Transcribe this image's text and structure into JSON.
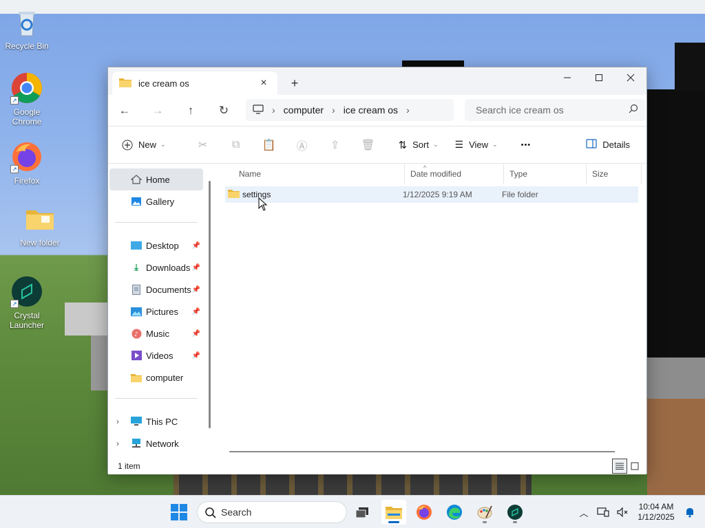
{
  "desktop": {
    "icons": [
      {
        "label": "Recycle Bin",
        "icon": "recycle-bin-icon"
      },
      {
        "label": "Google Chrome",
        "icon": "chrome-icon"
      },
      {
        "label": "Firefox",
        "icon": "firefox-icon"
      },
      {
        "label": "New folder",
        "icon": "folder-icon"
      },
      {
        "label": "Crystal Launcher",
        "icon": "crystal-launcher-icon"
      }
    ]
  },
  "window": {
    "tab_title": "ice cream os",
    "tab_close": "×",
    "new_tab": "+",
    "controls": {
      "minimize": "—",
      "maximize": "☐",
      "close": "✕"
    }
  },
  "address": {
    "back": "←",
    "forward": "→",
    "up": "↑",
    "refresh": "↻",
    "breadcrumbs": [
      "computer",
      "ice cream os"
    ],
    "search_placeholder": "Search ice cream os"
  },
  "commands": {
    "new_label": "New",
    "sort_label": "Sort",
    "view_label": "View",
    "more_label": "•••",
    "details_label": "Details"
  },
  "nav": {
    "home": "Home",
    "gallery": "Gallery",
    "desktop": "Desktop",
    "downloads": "Downloads",
    "documents": "Documents",
    "pictures": "Pictures",
    "music": "Music",
    "videos": "Videos",
    "computer": "computer",
    "this_pc": "This PC",
    "network": "Network"
  },
  "columns": [
    "Name",
    "Date modified",
    "Type",
    "Size"
  ],
  "files": [
    {
      "name": "settings",
      "date": "1/12/2025 9:19 AM",
      "type": "File folder",
      "size": ""
    }
  ],
  "status": {
    "item_count": "1 item"
  },
  "taskbar": {
    "search_label": "Search",
    "time": "10:04 AM",
    "date": "1/12/2025"
  },
  "colors": {
    "accent": "#0067c0",
    "selection": "#e9f1fb",
    "folder": "#f4c542"
  }
}
